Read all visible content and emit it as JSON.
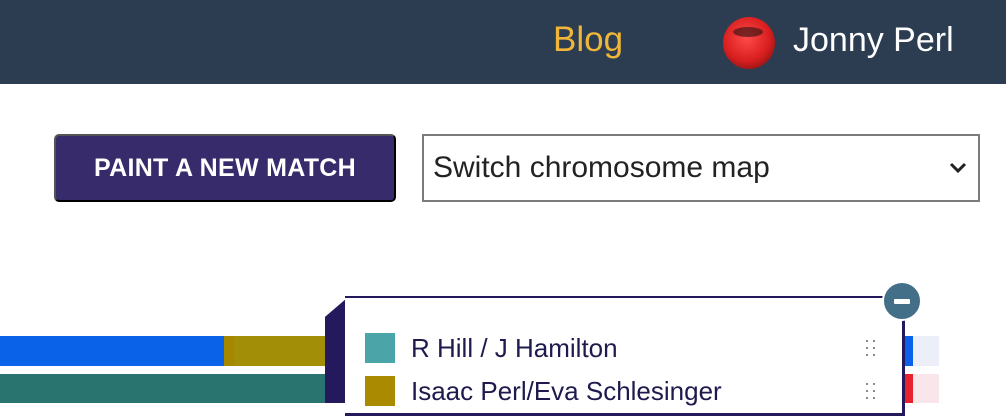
{
  "header": {
    "blog_label": "Blog",
    "user_name": "Jonny Perl"
  },
  "toolbar": {
    "paint_button_label": "PAINT A NEW MATCH",
    "chromosome_select_value": "Switch chromosome map"
  },
  "legend": {
    "items": [
      {
        "label": "R Hill / J Hamilton",
        "color": "#4aa4a8"
      },
      {
        "label": "Isaac Perl/Eva Schlesinger",
        "color": "#a98a00"
      }
    ]
  },
  "colors": {
    "header_bg": "#2c3c51",
    "blog_link": "#f0b63a",
    "button_bg": "#372b6b",
    "panel_border": "#25195e",
    "collapse_button": "#436f88"
  },
  "icons": {
    "avatar": "user-avatar",
    "select_chevron": "chevron-down-icon",
    "drag": "drag-handle-icon",
    "collapse": "minus-icon"
  }
}
